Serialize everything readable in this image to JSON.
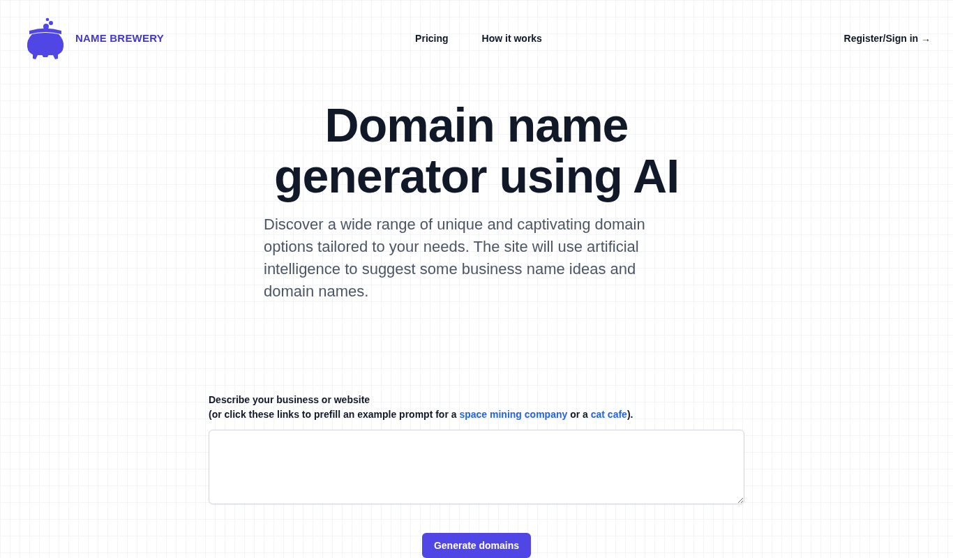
{
  "header": {
    "brand": "NAME BREWERY",
    "links": [
      "Pricing",
      "How it works"
    ],
    "account_link": "Register/Sign in →"
  },
  "hero": {
    "title": "Domain name generator using AI",
    "description": "Discover a wide range of unique and captivating domain options tailored to your needs. The site will use artificial intelligence to suggest some business name ideas and domain names."
  },
  "form": {
    "label": "Describe your business or website",
    "hint_parts": [
      {
        "kind": "text",
        "text": "(or click these links to prefill an example prompt for a "
      },
      {
        "kind": "link",
        "text": "space mining company"
      },
      {
        "kind": "text",
        "text": " or a "
      },
      {
        "kind": "link",
        "text": "cat cafe"
      },
      {
        "kind": "text",
        "text": ")."
      }
    ],
    "submit_button": "Generate domains"
  }
}
